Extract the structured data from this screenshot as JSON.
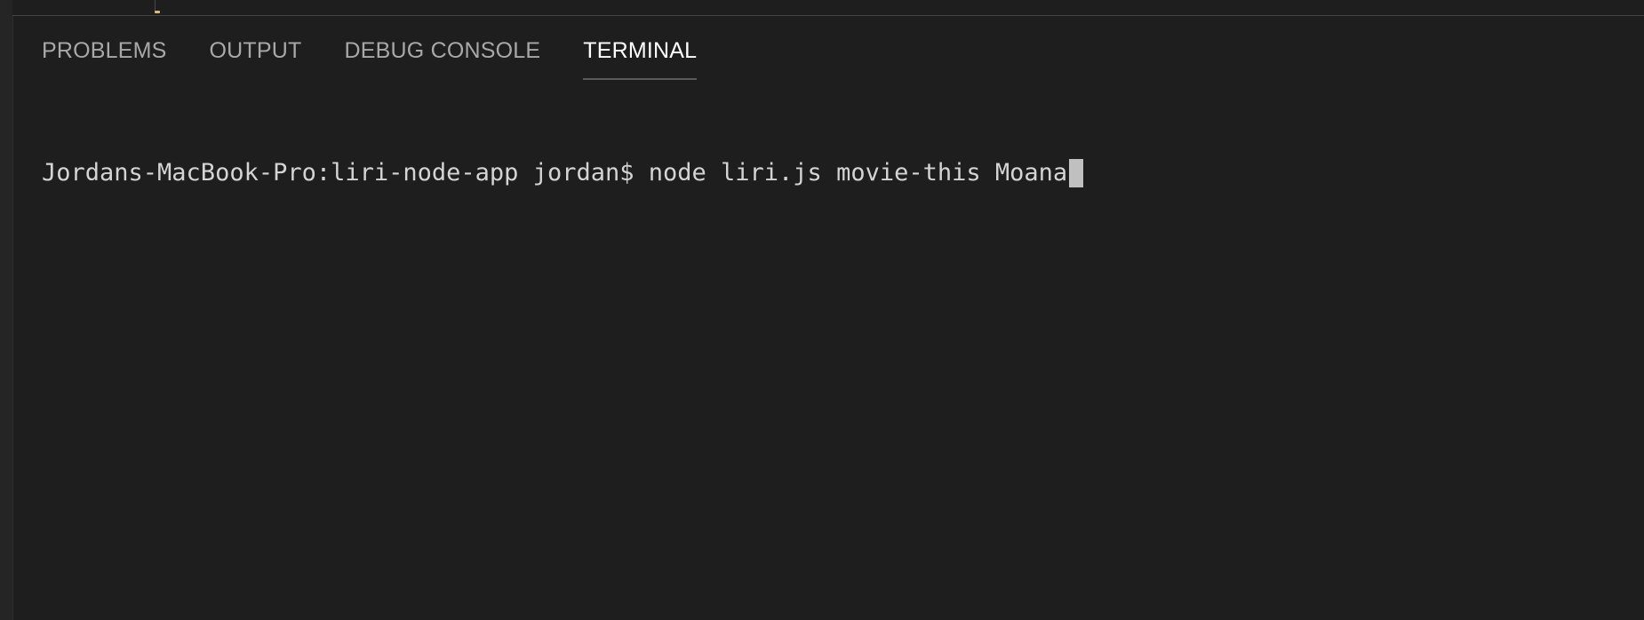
{
  "panel": {
    "tabs": [
      {
        "label": "PROBLEMS",
        "active": false
      },
      {
        "label": "OUTPUT",
        "active": false
      },
      {
        "label": "DEBUG CONSOLE",
        "active": false
      },
      {
        "label": "TERMINAL",
        "active": true
      }
    ]
  },
  "terminal": {
    "prompt": "Jordans-MacBook-Pro:liri-node-app jordan$",
    "command": "node liri.js movie-this Moana"
  },
  "colors": {
    "background": "#1e1e1e",
    "tab_inactive": "#a8a8a8",
    "tab_active": "#ffffff",
    "text": "#d4d4d4"
  }
}
